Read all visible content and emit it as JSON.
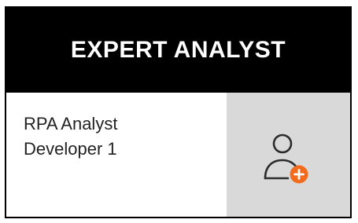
{
  "card": {
    "title": "EXPERT ANALYST",
    "role_line_1": "RPA Analyst",
    "role_line_2": "Developer 1"
  },
  "icons": {
    "add_user": "add-user-icon",
    "plus": "plus-icon"
  },
  "colors": {
    "header_background": "#000000",
    "header_text": "#ffffff",
    "panel_background": "#d9d9d9",
    "icon_stroke": "#2b2b2b",
    "accent_orange": "#f26a1b"
  }
}
